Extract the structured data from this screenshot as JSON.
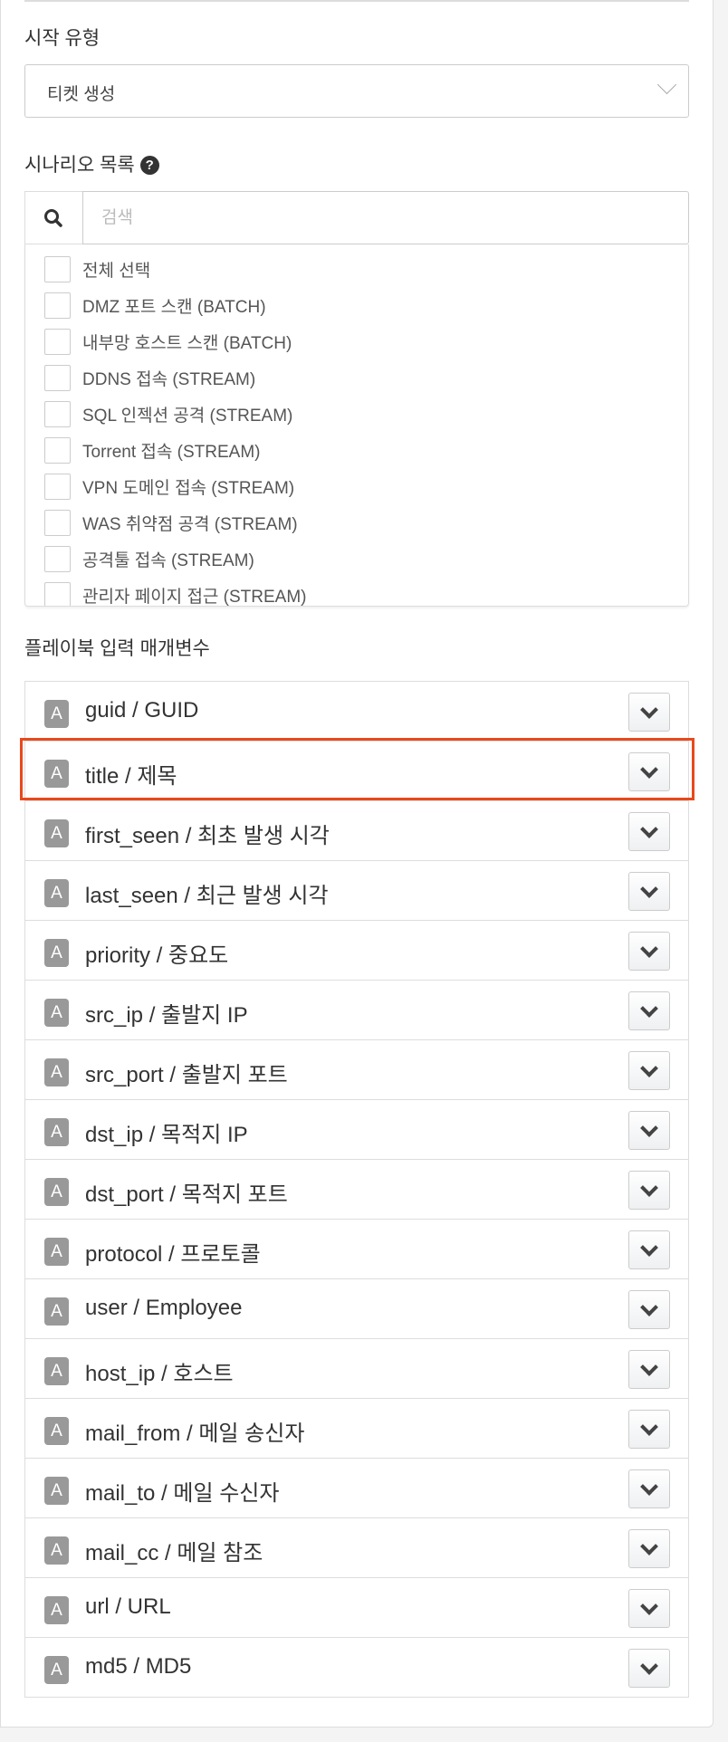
{
  "start_type": {
    "label": "시작 유형",
    "selected": "티켓 생성"
  },
  "scenario": {
    "label": "시나리오 목록",
    "help_icon": "question-circle-icon",
    "search_placeholder": "검색",
    "items": [
      "전체 선택",
      "DMZ 포트 스캔 (BATCH)",
      "내부망 호스트 스캔 (BATCH)",
      "DDNS 접속 (STREAM)",
      "SQL 인젝션 공격 (STREAM)",
      "Torrent 접속 (STREAM)",
      "VPN 도메인 접속 (STREAM)",
      "WAS 취약점 공격 (STREAM)",
      "공격툴 접속 (STREAM)",
      "관리자 페이지 접근 (STREAM)"
    ]
  },
  "params": {
    "label": "플레이북 입력 매개변수",
    "badge": "A",
    "highlight_color": "#e8491d",
    "highlighted_index": 1,
    "rows": [
      "guid / GUID",
      "title / 제목",
      "first_seen / 최초 발생 시각",
      "last_seen / 최근 발생 시각",
      "priority / 중요도",
      "src_ip / 출발지 IP",
      "src_port / 출발지 포트",
      "dst_ip / 목적지 IP",
      "dst_port / 목적지 포트",
      "protocol / 프로토콜",
      "user / Employee",
      "host_ip / 호스트",
      "mail_from / 메일 송신자",
      "mail_to / 메일 수신자",
      "mail_cc / 메일 참조",
      "url / URL",
      "md5 / MD5"
    ]
  }
}
